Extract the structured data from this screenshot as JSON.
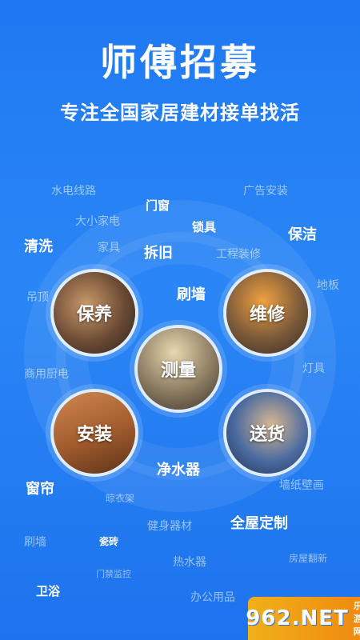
{
  "header": {
    "title": "师傅招募",
    "subtitle": "专注全国家居建材接单找活"
  },
  "services": {
    "baoyang": "保养",
    "weixiu": "维修",
    "celiang": "测量",
    "anzhuang": "安装",
    "songhuo": "送货"
  },
  "keywords": {
    "shuidian": "水电线路",
    "guanggao": "广告安装",
    "menchuang": "门窗",
    "daxiao": "大小家电",
    "suoju": "锁具",
    "qingxi": "清洗",
    "baojie": "保洁",
    "jiaju": "家具",
    "chaijiu": "拆旧",
    "gongcheng": "工程装修",
    "diaoding": "吊顶",
    "shuaqiang": "刷墙",
    "diban": "地板",
    "shangyong": "商用厨电",
    "dengju": "灯具",
    "jingshuiqi": "净水器",
    "chuanglian": "窗帘",
    "qiangzhi": "墙纸壁画",
    "liangyijia": "晾衣架",
    "jianshen": "健身器材",
    "quanwu": "全屋定制",
    "shuaqiang2": "刷墙",
    "cizhuan": "瓷砖",
    "reshuiqi": "热水器",
    "fangwu": "房屋翻新",
    "menjin": "门禁监控",
    "weiyu": "卫浴",
    "bangong": "办公用品"
  },
  "badge": {
    "logo": "962.NET",
    "sub": "乐游网"
  }
}
